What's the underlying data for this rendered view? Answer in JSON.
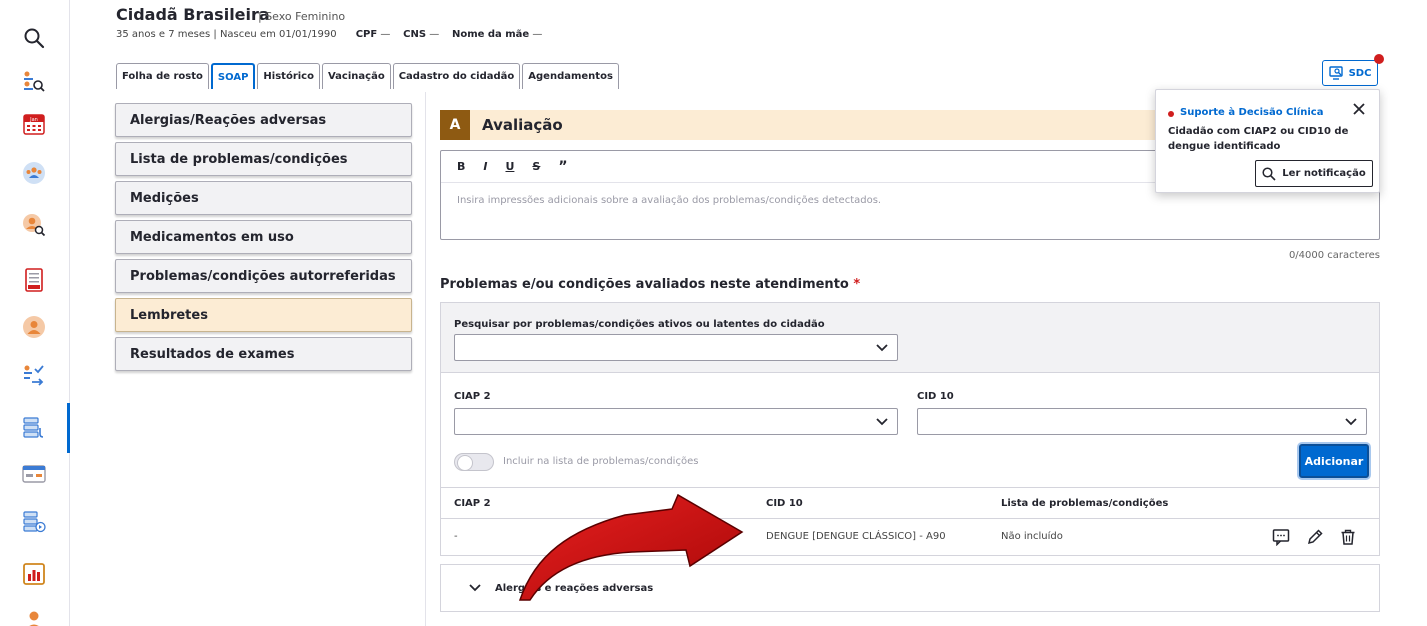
{
  "patient": {
    "name": "Cidadã Brasileira",
    "sex": "| Sexo Feminino",
    "age_birth": "35 anos e 7 meses | Nasceu em 01/01/1990",
    "cpf_label": "CPF",
    "cpf_value": "—",
    "cns_label": "CNS",
    "cns_value": "—",
    "mother_label": "Nome da mãe",
    "mother_value": "—"
  },
  "tabs": [
    {
      "label": "Folha de rosto"
    },
    {
      "label": "SOAP",
      "active": true
    },
    {
      "label": "Histórico"
    },
    {
      "label": "Vacinação"
    },
    {
      "label": "Cadastro do cidadão"
    },
    {
      "label": "Agendamentos"
    }
  ],
  "sdc": {
    "label": "SDC"
  },
  "rail_icons": [
    "search-icon",
    "attendance-queue-icon",
    "calendar-icon",
    "group-icon",
    "patient-search-icon",
    "cds-document-icon",
    "citizen-icon",
    "checklist-icon",
    "records-icon",
    "card-icon",
    "video-records-icon",
    "report-chart-icon",
    "person-icon"
  ],
  "calendar_label": "Jan",
  "menu": {
    "items": [
      {
        "label": "Alergias/Reações adversas"
      },
      {
        "label": "Lista de problemas/condições"
      },
      {
        "label": "Medições"
      },
      {
        "label": "Medicamentos em uso"
      },
      {
        "label": "Problemas/condições autorreferidas"
      },
      {
        "label": "Lembretes",
        "active": true
      },
      {
        "label": "Resultados de exames"
      }
    ]
  },
  "avaliacao": {
    "badge": "A",
    "title": "Avaliação",
    "toolbar": [
      "B",
      "I",
      "U",
      "S",
      "”"
    ],
    "placeholder": "Insira impressões adicionais sobre a avaliação dos problemas/condições detectados.",
    "char_count": "0/4000 caracteres"
  },
  "problems": {
    "title": "Problemas e/ou condições avaliados neste atendimento",
    "required_mark": "*",
    "search_label": "Pesquisar por problemas/condições ativos ou latentes do cidadão",
    "ciap_label": "CIAP 2",
    "cid_label": "CID 10",
    "toggle_label": "Incluir na lista de problemas/condições",
    "add_button": "Adicionar",
    "table": {
      "headers": [
        "CIAP 2",
        "CID 10",
        "Lista de problemas/condições"
      ],
      "rows": [
        {
          "ciap": "-",
          "cid": "DENGUE [DENGUE CLÁSSICO] - A90",
          "lista": "Não incluído"
        }
      ]
    }
  },
  "accordion": {
    "label": "Alergias e reações adversas"
  },
  "notification": {
    "title": "Suporte à Decisão Clínica",
    "message": "Cidadão com CIAP2 ou CID10 de dengue identificado",
    "button": "Ler notificação"
  },
  "colors": {
    "primary": "#0069d0",
    "section_bg": "#fcecd4",
    "section_badge": "#8e5a12",
    "alert_red": "#d01e1e",
    "annotation_arrow": "#c41010"
  }
}
